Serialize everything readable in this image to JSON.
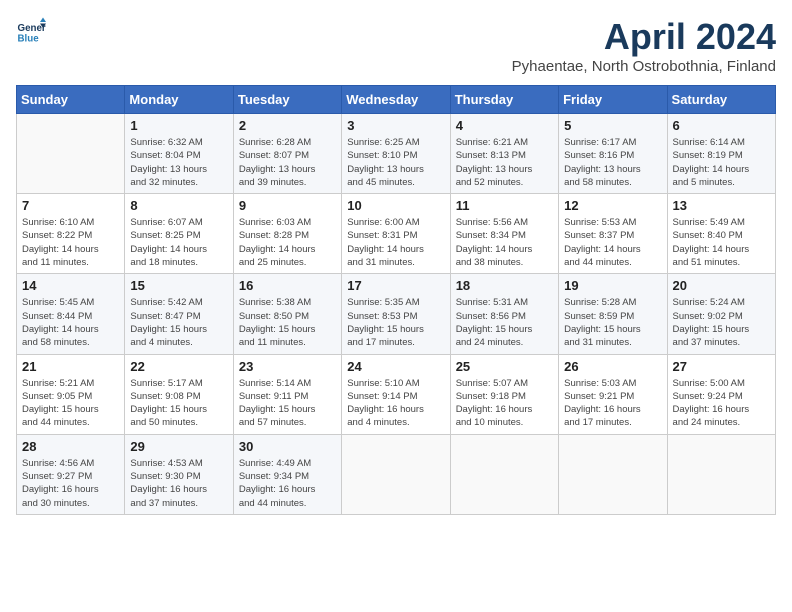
{
  "header": {
    "logo_line1": "General",
    "logo_line2": "Blue",
    "month_title": "April 2024",
    "subtitle": "Pyhaentae, North Ostrobothnia, Finland"
  },
  "days_of_week": [
    "Sunday",
    "Monday",
    "Tuesday",
    "Wednesday",
    "Thursday",
    "Friday",
    "Saturday"
  ],
  "weeks": [
    [
      {
        "num": "",
        "info": ""
      },
      {
        "num": "1",
        "info": "Sunrise: 6:32 AM\nSunset: 8:04 PM\nDaylight: 13 hours\nand 32 minutes."
      },
      {
        "num": "2",
        "info": "Sunrise: 6:28 AM\nSunset: 8:07 PM\nDaylight: 13 hours\nand 39 minutes."
      },
      {
        "num": "3",
        "info": "Sunrise: 6:25 AM\nSunset: 8:10 PM\nDaylight: 13 hours\nand 45 minutes."
      },
      {
        "num": "4",
        "info": "Sunrise: 6:21 AM\nSunset: 8:13 PM\nDaylight: 13 hours\nand 52 minutes."
      },
      {
        "num": "5",
        "info": "Sunrise: 6:17 AM\nSunset: 8:16 PM\nDaylight: 13 hours\nand 58 minutes."
      },
      {
        "num": "6",
        "info": "Sunrise: 6:14 AM\nSunset: 8:19 PM\nDaylight: 14 hours\nand 5 minutes."
      }
    ],
    [
      {
        "num": "7",
        "info": "Sunrise: 6:10 AM\nSunset: 8:22 PM\nDaylight: 14 hours\nand 11 minutes."
      },
      {
        "num": "8",
        "info": "Sunrise: 6:07 AM\nSunset: 8:25 PM\nDaylight: 14 hours\nand 18 minutes."
      },
      {
        "num": "9",
        "info": "Sunrise: 6:03 AM\nSunset: 8:28 PM\nDaylight: 14 hours\nand 25 minutes."
      },
      {
        "num": "10",
        "info": "Sunrise: 6:00 AM\nSunset: 8:31 PM\nDaylight: 14 hours\nand 31 minutes."
      },
      {
        "num": "11",
        "info": "Sunrise: 5:56 AM\nSunset: 8:34 PM\nDaylight: 14 hours\nand 38 minutes."
      },
      {
        "num": "12",
        "info": "Sunrise: 5:53 AM\nSunset: 8:37 PM\nDaylight: 14 hours\nand 44 minutes."
      },
      {
        "num": "13",
        "info": "Sunrise: 5:49 AM\nSunset: 8:40 PM\nDaylight: 14 hours\nand 51 minutes."
      }
    ],
    [
      {
        "num": "14",
        "info": "Sunrise: 5:45 AM\nSunset: 8:44 PM\nDaylight: 14 hours\nand 58 minutes."
      },
      {
        "num": "15",
        "info": "Sunrise: 5:42 AM\nSunset: 8:47 PM\nDaylight: 15 hours\nand 4 minutes."
      },
      {
        "num": "16",
        "info": "Sunrise: 5:38 AM\nSunset: 8:50 PM\nDaylight: 15 hours\nand 11 minutes."
      },
      {
        "num": "17",
        "info": "Sunrise: 5:35 AM\nSunset: 8:53 PM\nDaylight: 15 hours\nand 17 minutes."
      },
      {
        "num": "18",
        "info": "Sunrise: 5:31 AM\nSunset: 8:56 PM\nDaylight: 15 hours\nand 24 minutes."
      },
      {
        "num": "19",
        "info": "Sunrise: 5:28 AM\nSunset: 8:59 PM\nDaylight: 15 hours\nand 31 minutes."
      },
      {
        "num": "20",
        "info": "Sunrise: 5:24 AM\nSunset: 9:02 PM\nDaylight: 15 hours\nand 37 minutes."
      }
    ],
    [
      {
        "num": "21",
        "info": "Sunrise: 5:21 AM\nSunset: 9:05 PM\nDaylight: 15 hours\nand 44 minutes."
      },
      {
        "num": "22",
        "info": "Sunrise: 5:17 AM\nSunset: 9:08 PM\nDaylight: 15 hours\nand 50 minutes."
      },
      {
        "num": "23",
        "info": "Sunrise: 5:14 AM\nSunset: 9:11 PM\nDaylight: 15 hours\nand 57 minutes."
      },
      {
        "num": "24",
        "info": "Sunrise: 5:10 AM\nSunset: 9:14 PM\nDaylight: 16 hours\nand 4 minutes."
      },
      {
        "num": "25",
        "info": "Sunrise: 5:07 AM\nSunset: 9:18 PM\nDaylight: 16 hours\nand 10 minutes."
      },
      {
        "num": "26",
        "info": "Sunrise: 5:03 AM\nSunset: 9:21 PM\nDaylight: 16 hours\nand 17 minutes."
      },
      {
        "num": "27",
        "info": "Sunrise: 5:00 AM\nSunset: 9:24 PM\nDaylight: 16 hours\nand 24 minutes."
      }
    ],
    [
      {
        "num": "28",
        "info": "Sunrise: 4:56 AM\nSunset: 9:27 PM\nDaylight: 16 hours\nand 30 minutes."
      },
      {
        "num": "29",
        "info": "Sunrise: 4:53 AM\nSunset: 9:30 PM\nDaylight: 16 hours\nand 37 minutes."
      },
      {
        "num": "30",
        "info": "Sunrise: 4:49 AM\nSunset: 9:34 PM\nDaylight: 16 hours\nand 44 minutes."
      },
      {
        "num": "",
        "info": ""
      },
      {
        "num": "",
        "info": ""
      },
      {
        "num": "",
        "info": ""
      },
      {
        "num": "",
        "info": ""
      }
    ]
  ]
}
